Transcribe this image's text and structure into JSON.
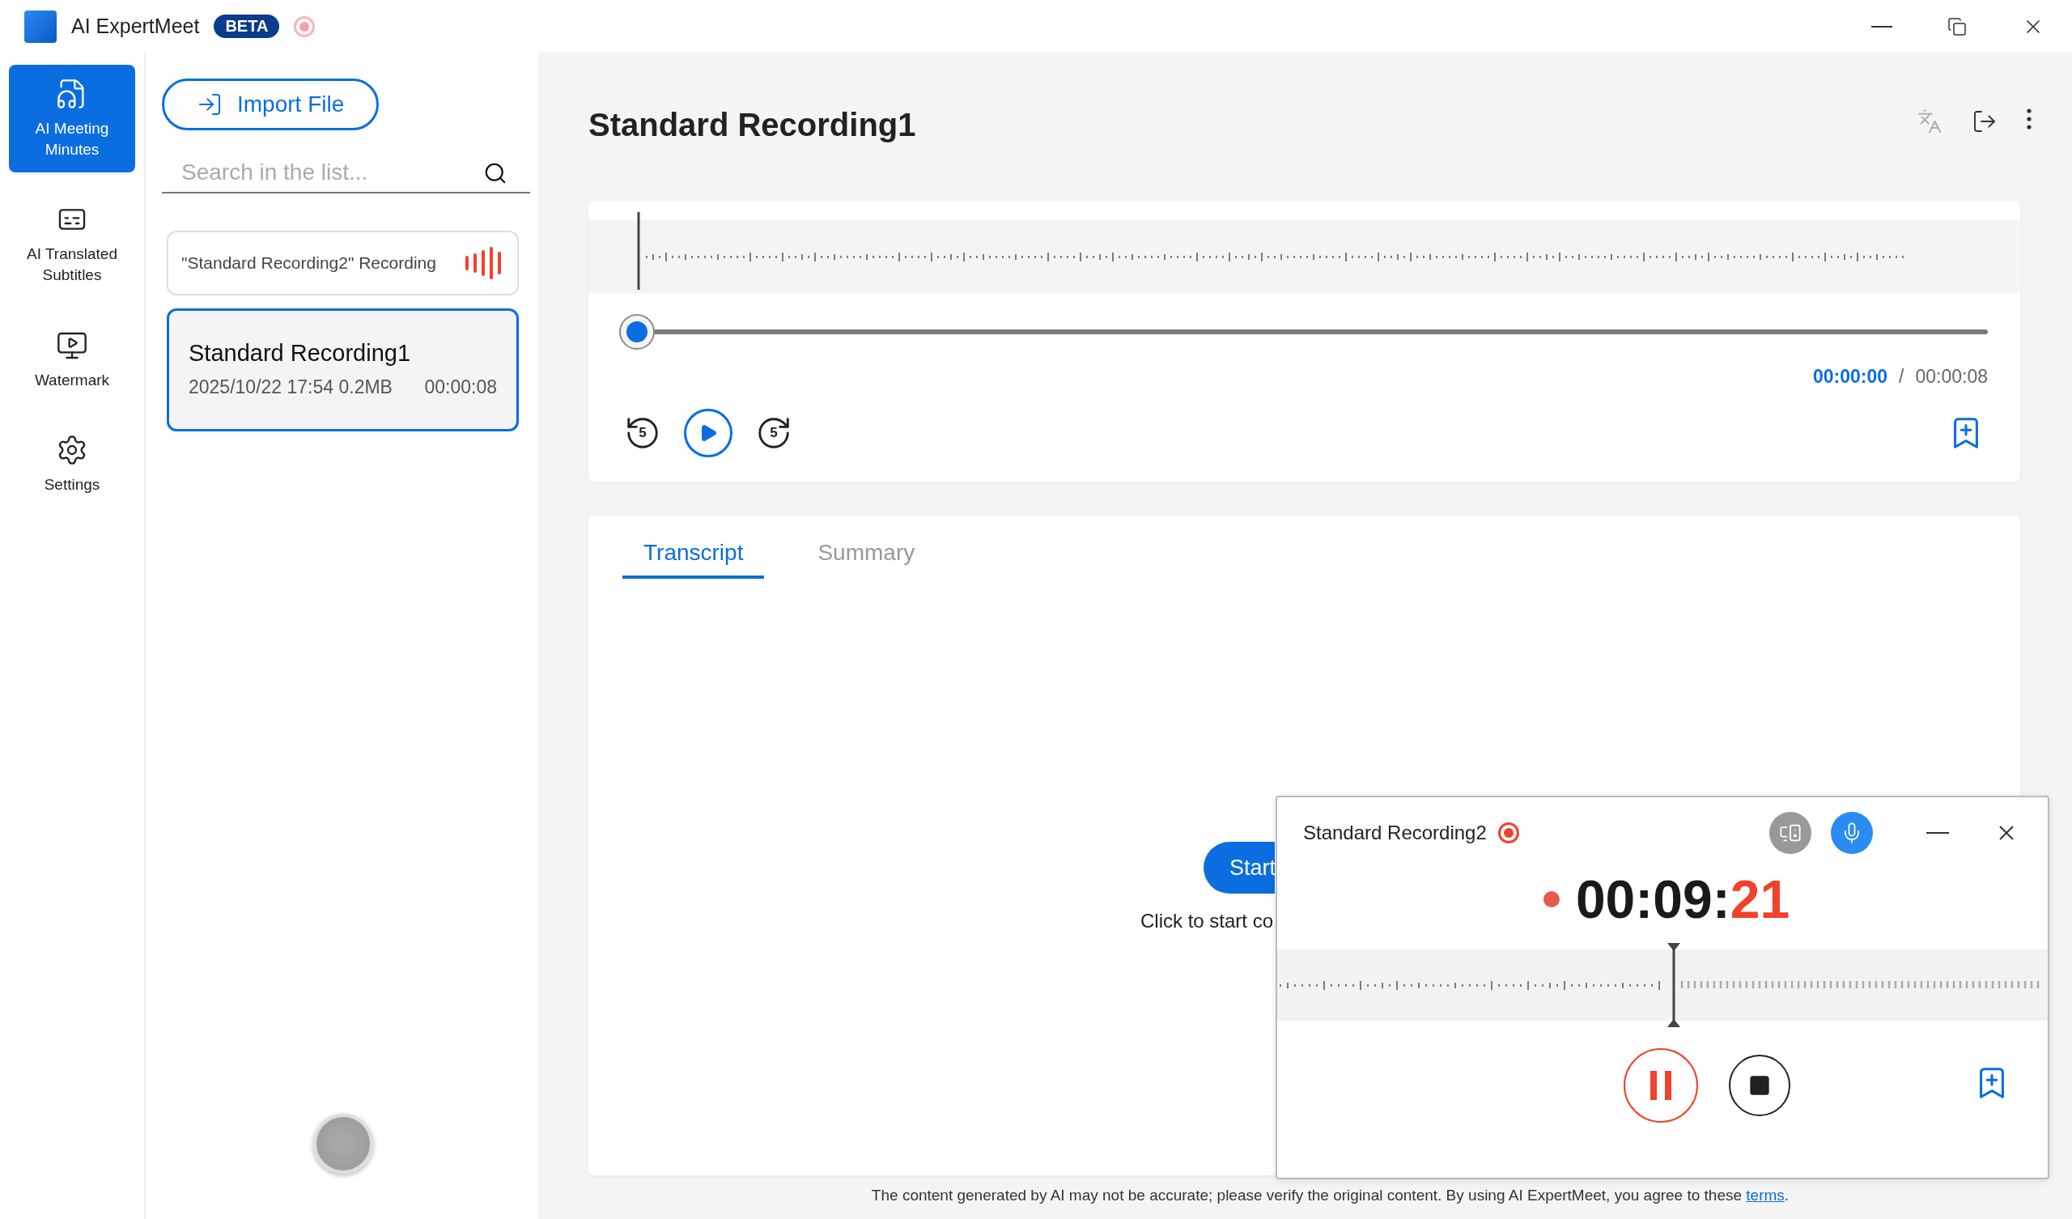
{
  "app": {
    "name": "AI ExpertMeet",
    "badge": "BETA"
  },
  "sidebar": {
    "items": [
      {
        "kind": "minutes",
        "label": "AI Meeting Minutes",
        "selected": true
      },
      {
        "kind": "subtitles",
        "label": "AI Translated Subtitles",
        "selected": false
      },
      {
        "kind": "watermark",
        "label": "Watermark",
        "selected": false
      },
      {
        "kind": "settings",
        "label": "Settings",
        "selected": false
      }
    ]
  },
  "list_panel": {
    "import_button": "Import File",
    "search": {
      "placeholder": "Search in the list..."
    },
    "items": [
      {
        "kind": "recording",
        "title": "\"Standard Recording2\" Recording",
        "selected": false
      },
      {
        "kind": "file",
        "title": "Standard Recording1",
        "meta": "2025/10/22 17:54 0.2MB",
        "duration": "00:00:08",
        "selected": true
      }
    ]
  },
  "main": {
    "title": "Standard Recording1",
    "player": {
      "level": 0,
      "current_time": "00:00:00",
      "separator": "/",
      "total_time": "00:00:08",
      "skip_back": "5",
      "skip_forward": "5"
    },
    "tabs": [
      {
        "label": "Transcript",
        "selected": true
      },
      {
        "label": "Summary",
        "selected": false
      }
    ],
    "start_button": "Start",
    "hint": "Click to start co"
  },
  "footer": {
    "text": "The content generated by AI may not be accurate; please verify the original content. By using AI ExpertMeet, you agree to these ",
    "link": "terms",
    "end": "."
  },
  "recorder": {
    "title": "Standard Recording2",
    "mic_on": true,
    "timer": {
      "main": "00:09:",
      "seconds": "21"
    }
  }
}
